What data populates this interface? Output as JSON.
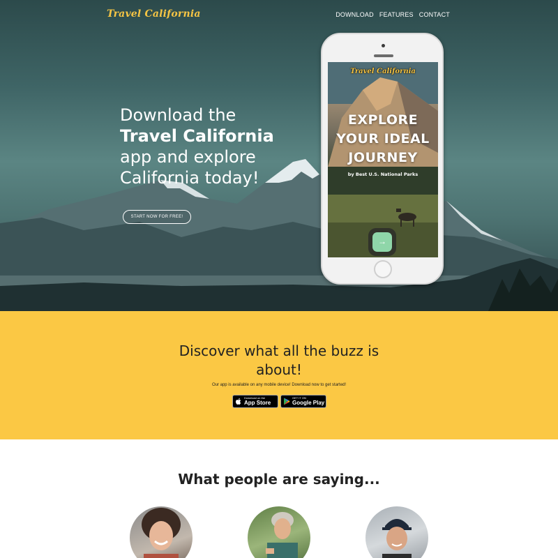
{
  "nav": {
    "brand": "Travel California",
    "links": [
      "DOWNLOAD",
      "FEATURES",
      "CONTACT"
    ]
  },
  "hero": {
    "heading_parts": [
      "Download the ",
      "Travel California",
      " app and explore California today!"
    ],
    "cta_label": "START NOW FOR FREE!"
  },
  "phone": {
    "brand": "Travel California",
    "title": "EXPLORE YOUR IDEAL JOURNEY",
    "subtitle": "by Best U.S. National Parks",
    "button_icon": "→"
  },
  "download": {
    "heading": "Discover what all the buzz is about!",
    "subtext": "Our app is available on any mobile device! Download now to get started!",
    "app_store": {
      "small": "Download on the",
      "big": "App Store",
      "icon": "apple-icon"
    },
    "google_play": {
      "small": "GET IT ON",
      "big": "Google Play",
      "icon": "google-play-icon"
    }
  },
  "testimonials": {
    "heading": "What people are saying..."
  },
  "colors": {
    "brand_yellow": "#fbc844",
    "accent_green": "#8fd6a9"
  }
}
